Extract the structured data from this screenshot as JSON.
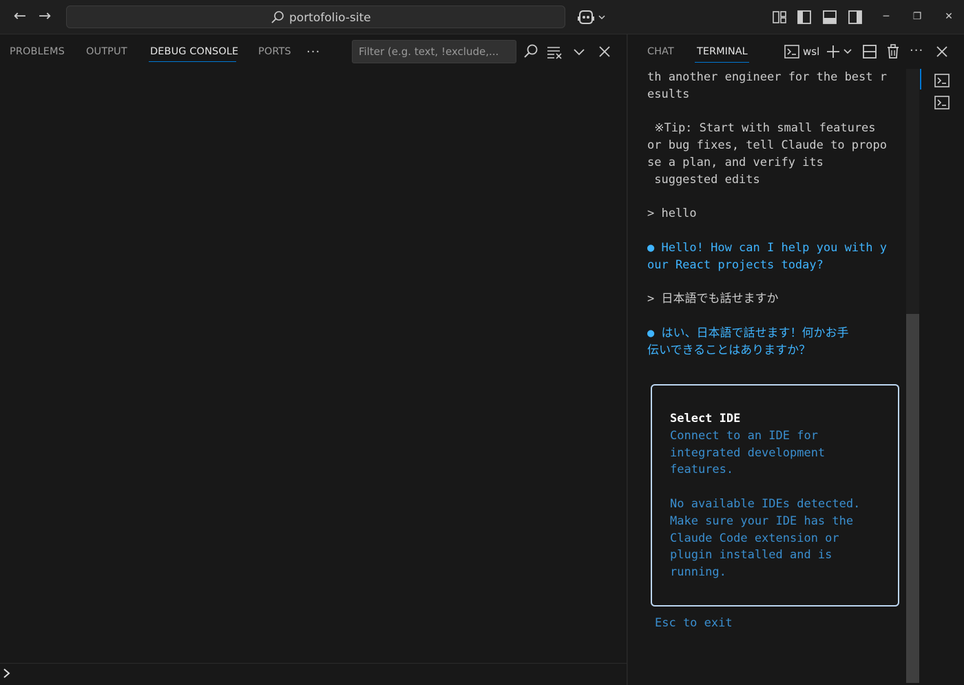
{
  "titlebar": {
    "back_glyph": "←",
    "forward_glyph": "→",
    "command_center_text": "portofolio-site",
    "icons": [
      "search-icon",
      "copilot-icon",
      "chevron-down-icon",
      "customize-layout-icon",
      "toggle-primary-sidebar-icon",
      "toggle-panel-icon",
      "toggle-secondary-sidebar-icon"
    ],
    "window_controls": {
      "minimize": "─",
      "restore": "❐",
      "close": "✕"
    }
  },
  "panel_left": {
    "tabs": [
      {
        "label": "PROBLEMS",
        "active": false
      },
      {
        "label": "OUTPUT",
        "active": false
      },
      {
        "label": "DEBUG CONSOLE",
        "active": true
      },
      {
        "label": "PORTS",
        "active": false
      }
    ],
    "more": "···",
    "filter_placeholder": "Filter (e.g. text, !exclude,...",
    "filter_value": "",
    "tool_icons": [
      "search-icon",
      "clear-console-icon",
      "chevron-down-icon",
      "close-icon"
    ],
    "console_prompt": "›"
  },
  "panel_right": {
    "tabs": [
      {
        "label": "CHAT",
        "active": false
      },
      {
        "label": "TERMINAL",
        "active": true
      }
    ],
    "terminal_name": "wsl",
    "more": "···",
    "terminal_lines": [
      {
        "text": "th another engineer for the best r",
        "style": "normal"
      },
      {
        "text": "esults",
        "style": "normal"
      },
      {
        "text": "",
        "style": "normal"
      },
      {
        "text": " ※Tip: Start with small features",
        "style": "normal"
      },
      {
        "text": "or bug fixes, tell Claude to propo",
        "style": "normal"
      },
      {
        "text": "se a plan, and verify its",
        "style": "normal"
      },
      {
        "text": " suggested edits",
        "style": "normal"
      },
      {
        "text": "",
        "style": "normal"
      },
      {
        "text": "> hello",
        "style": "normal"
      },
      {
        "text": "",
        "style": "normal"
      },
      {
        "text": "● Hello! How can I help you with y",
        "style": "blue"
      },
      {
        "text": "our React projects today?",
        "style": "blue"
      },
      {
        "text": "",
        "style": "normal"
      },
      {
        "text": "> 日本語でも話せますか",
        "style": "normal"
      },
      {
        "text": "",
        "style": "normal"
      },
      {
        "text": "● はい、日本語で話せます！何かお手",
        "style": "blue"
      },
      {
        "text": "伝いできることはありますか？",
        "style": "blue"
      }
    ],
    "ide_dialog": {
      "title": "Select IDE",
      "lines": [
        "Connect to an IDE for",
        "integrated development",
        "features.",
        "",
        "No available IDEs detected.",
        "Make sure your IDE has the",
        "Claude Code extension or",
        "plugin installed and is",
        "running."
      ]
    },
    "esc_hint": "Esc to exit",
    "accent_color": "#0078d4",
    "claude_text_color": "#3fb4ff",
    "dialog_text_color": "#3a8fd0"
  }
}
